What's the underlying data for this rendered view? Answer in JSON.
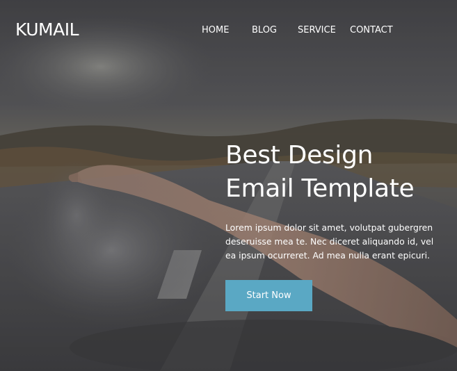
{
  "brand": {
    "logo_text": "KUMAIL"
  },
  "nav": {
    "items": [
      {
        "label": "HOME"
      },
      {
        "label": "BLOG"
      },
      {
        "label": "SERVICE"
      },
      {
        "label": "CONTACT"
      }
    ]
  },
  "hero": {
    "headline_line1": "Best Design",
    "headline_line2": "Email Template",
    "body_line1": "Lorem ipsum dolor sit amet, volutpat gubergren",
    "body_line2": "deseruisse mea te. Nec diceret aliquando id, vel",
    "body_line3": "ea ipsum ocurreret. Ad mea nulla erant epicuri.",
    "cta_label": "Start Now",
    "background_image": "swimmer-arm-on-road-photo"
  },
  "colors": {
    "cta": "#5aa8c4",
    "text": "#ffffff",
    "overlay": "#3a3a3e"
  }
}
